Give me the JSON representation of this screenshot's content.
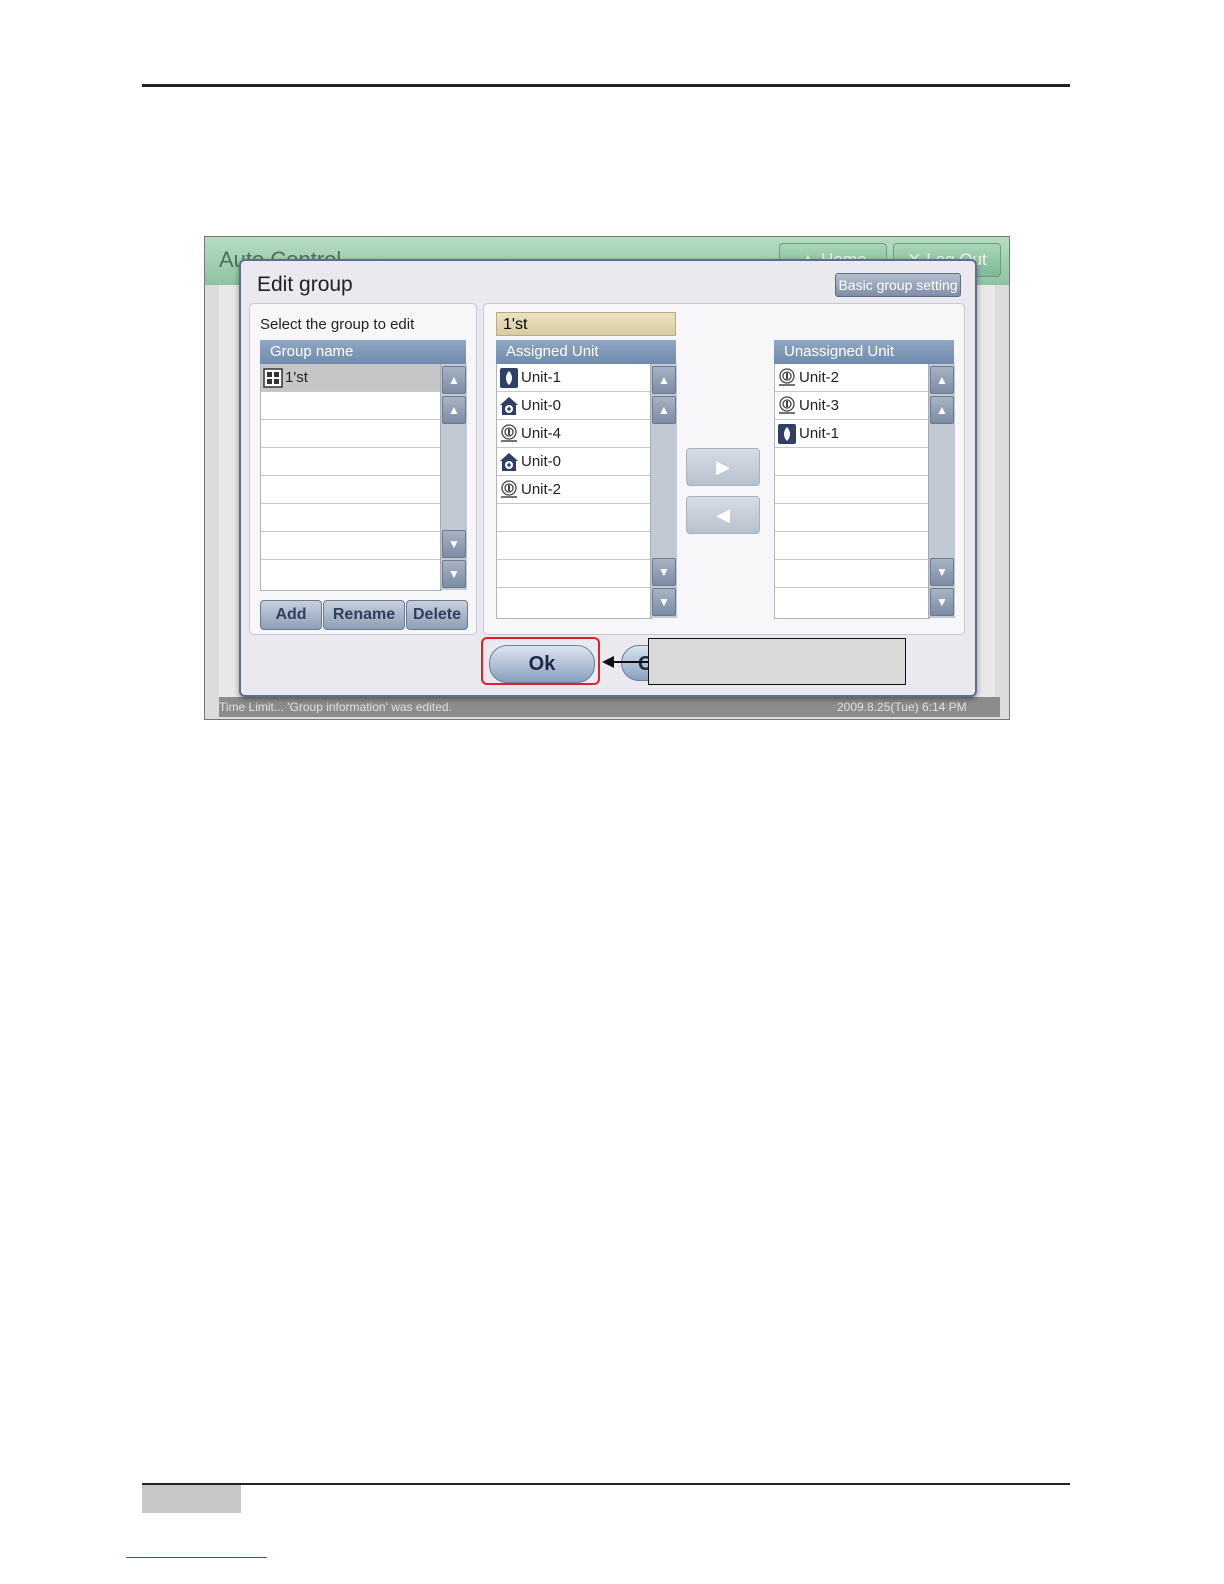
{
  "app": {
    "title": "Auto Control",
    "home_label": "Home",
    "logout_label": "Log Out",
    "status_message": "Time Limit... 'Group information' was edited.",
    "status_datetime": "2009.8.25(Tue)  6:14 PM"
  },
  "dialog": {
    "title": "Edit group",
    "basic_group_setting_label": "Basic group setting",
    "select_label": "Select the group to edit",
    "group_list": {
      "header": "Group name",
      "items": [
        {
          "label": "1'st",
          "icon": "group-grid-icon",
          "selected": true
        }
      ]
    },
    "add_label": "Add",
    "rename_label": "Rename",
    "delete_label": "Delete",
    "current_group": "1'st",
    "assigned": {
      "header": "Assigned Unit",
      "items": [
        {
          "label": "Unit-1",
          "icon": "ahu-unit-icon"
        },
        {
          "label": "Unit-0",
          "icon": "home-unit-icon"
        },
        {
          "label": "Unit-4",
          "icon": "ventilation-unit-icon"
        },
        {
          "label": "Unit-0",
          "icon": "home-unit-icon"
        },
        {
          "label": "Unit-2",
          "icon": "ventilation-unit-icon"
        }
      ]
    },
    "unassigned": {
      "header": "Unassigned Unit",
      "items": [
        {
          "label": "Unit-2",
          "icon": "ventilation-unit-icon"
        },
        {
          "label": "Unit-3",
          "icon": "ventilation-unit-icon"
        },
        {
          "label": "Unit-1",
          "icon": "ahu-unit-icon"
        }
      ]
    },
    "ok_label": "Ok",
    "cancel_label": "C"
  },
  "colors": {
    "highlight": "#e0202a",
    "header_green": "#8fc3a1",
    "list_header": "#6f8bae"
  }
}
